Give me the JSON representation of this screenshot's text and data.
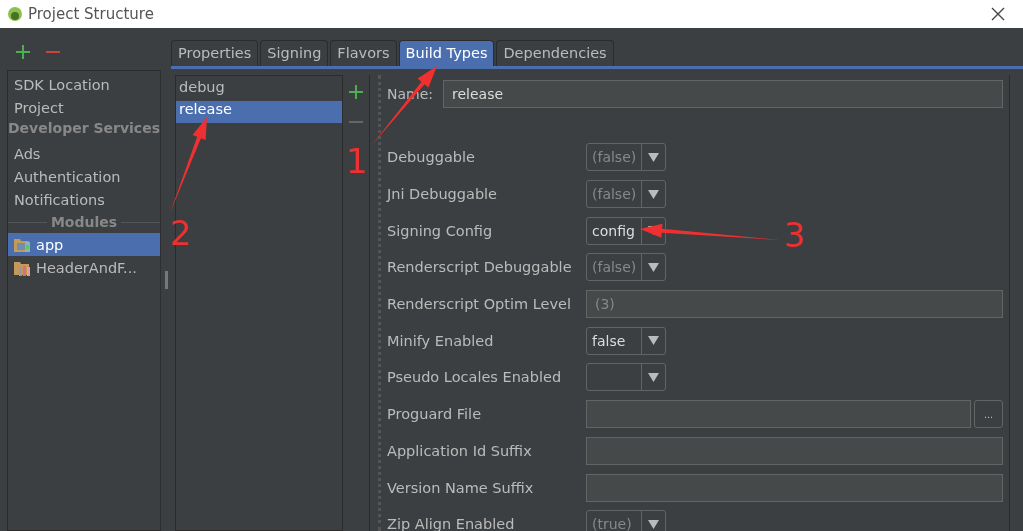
{
  "window": {
    "title": "Project Structure"
  },
  "sidebar": {
    "items": [
      {
        "label": "SDK Location",
        "kind": "item",
        "selected": false
      },
      {
        "label": "Project",
        "kind": "item",
        "selected": false
      },
      {
        "label": "Developer Services",
        "kind": "header"
      },
      {
        "label": "Ads",
        "kind": "item",
        "selected": false
      },
      {
        "label": "Authentication",
        "kind": "item",
        "selected": false
      },
      {
        "label": "Notifications",
        "kind": "item",
        "selected": false
      },
      {
        "label": "Modules",
        "kind": "separator"
      },
      {
        "label": "app",
        "kind": "module",
        "selected": true
      },
      {
        "label": "HeaderAndF...",
        "kind": "library",
        "selected": false
      }
    ]
  },
  "tabs": [
    {
      "label": "Properties",
      "selected": false
    },
    {
      "label": "Signing",
      "selected": false
    },
    {
      "label": "Flavors",
      "selected": false
    },
    {
      "label": "Build Types",
      "selected": true
    },
    {
      "label": "Dependencies",
      "selected": false
    }
  ],
  "build_types": [
    {
      "label": "debug",
      "selected": false
    },
    {
      "label": "release",
      "selected": true
    }
  ],
  "name_field": {
    "label": "Name:",
    "value": "release"
  },
  "fields": [
    {
      "label": "Debuggable",
      "kind": "combo",
      "value": "(false)",
      "inherited": true
    },
    {
      "label": "Jni Debuggable",
      "kind": "combo",
      "value": "(false)",
      "inherited": true
    },
    {
      "label": "Signing Config",
      "kind": "combo",
      "value": "config",
      "inherited": false
    },
    {
      "label": "Renderscript Debuggable",
      "kind": "combo",
      "value": "(false)",
      "inherited": true
    },
    {
      "label": "Renderscript Optim Level",
      "kind": "text",
      "value": "(3)",
      "inherited": true
    },
    {
      "label": "Minify Enabled",
      "kind": "combo",
      "value": "false",
      "inherited": false
    },
    {
      "label": "Pseudo Locales Enabled",
      "kind": "combo"
    },
    {
      "label": "Proguard File",
      "kind": "file",
      "button": "..."
    },
    {
      "label": "Application Id Suffix",
      "kind": "text"
    },
    {
      "label": "Version Name Suffix",
      "kind": "text"
    },
    {
      "label": "Zip Align Enabled",
      "kind": "combo",
      "value": "(true)",
      "inherited": true
    }
  ],
  "annotations": [
    {
      "label": "1"
    },
    {
      "label": "2"
    },
    {
      "label": "3"
    }
  ]
}
